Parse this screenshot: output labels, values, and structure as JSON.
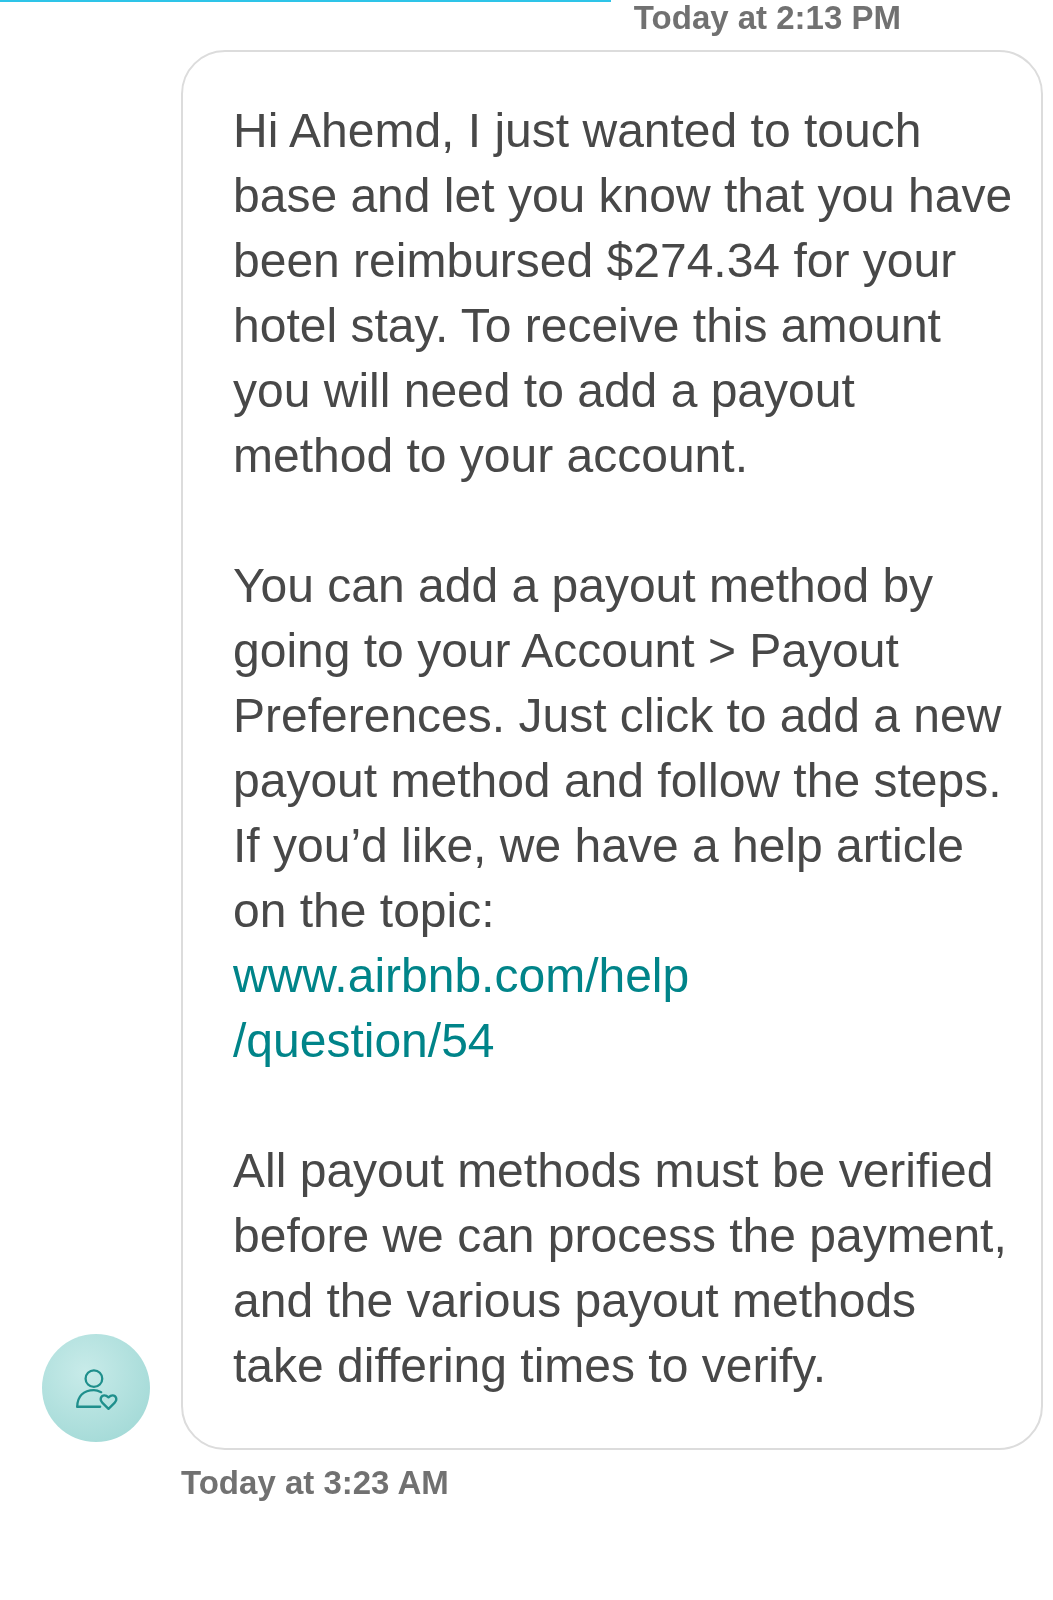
{
  "messages": [
    {
      "timestamp": "Today at 2:13 PM",
      "paragraphs": [
        {
          "kind": "text",
          "text": "Hi Ahemd, I just wanted to touch base and let you know that you have been reimbursed $274.34 for your hotel stay. To receive this amount you will need to add a payout method to your account."
        },
        {
          "kind": "text_link",
          "text": "You can add a payout method by going to your Account > Payout Preferences. Just click to add a new payout method and follow the steps. If you’d like, we have a help article on the topic:",
          "link_lines": [
            "www.airbnb.com/help",
            "/question/54"
          ]
        },
        {
          "kind": "text",
          "text": "All payout methods must be verified before we can process the payment, and the various payout methods take differing times to verify."
        }
      ]
    }
  ],
  "next_timestamp": "Today at 3:23 AM"
}
